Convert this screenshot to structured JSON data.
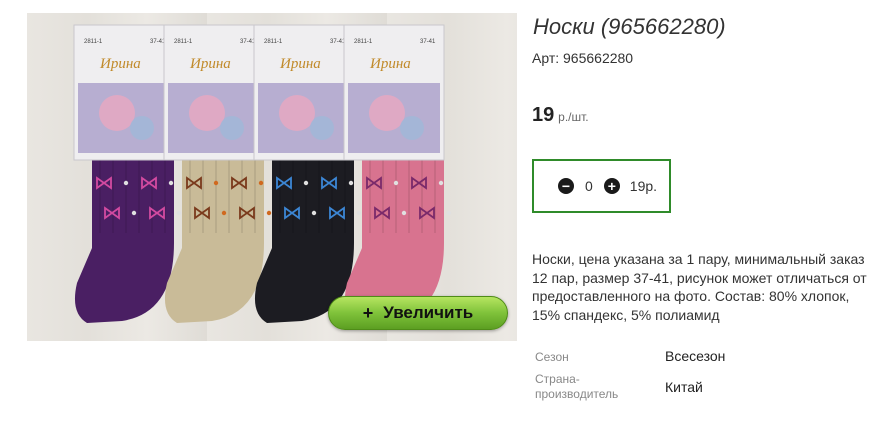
{
  "product": {
    "title": "Носки (965662280)",
    "article_label": "Арт: 965662280",
    "price_value": "19",
    "price_unit": "р./шт.",
    "description": "Носки, цена указана за 1 пару, минимальный заказ 12 пар, размер 37-41, рисунок может отличаться от предоставленного на фото. Состав: 80% хлопок, 15% спандекс, 5% полиамид"
  },
  "quantity": {
    "value": "0",
    "sum": "19р."
  },
  "image": {
    "zoom_label": "Увеличить",
    "zoom_icon": "+",
    "brand": "Ирина",
    "model": "2811-1",
    "size": "37-41",
    "sock_colors": [
      "#4a1f63",
      "#c9bb98",
      "#1c1c22",
      "#d8738f"
    ]
  },
  "properties": [
    {
      "key": "Сезон",
      "value": "Всесезон"
    },
    {
      "key": "Страна-производитель",
      "key_line1": "Страна-",
      "key_line2": "производитель",
      "value": "Китай"
    }
  ]
}
